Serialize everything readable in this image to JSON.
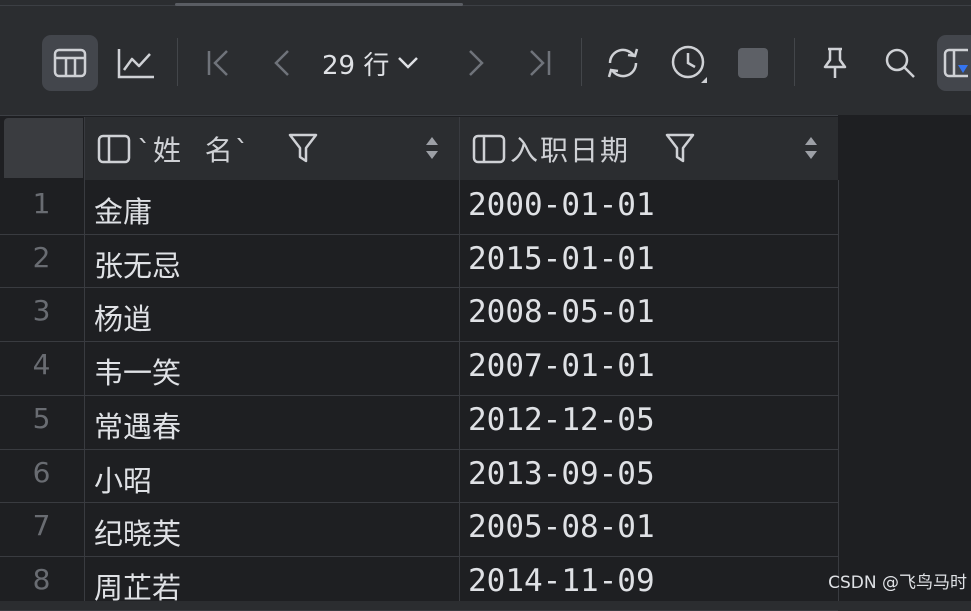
{
  "toolbar": {
    "row_count": "29 行",
    "buttons": [
      "table-view",
      "chart-view",
      "first-page",
      "previous-page",
      "next-page",
      "last-page",
      "refresh",
      "history",
      "stop",
      "pin",
      "search",
      "view-options"
    ]
  },
  "grid": {
    "columns": [
      {
        "label": "`姓  名`"
      },
      {
        "label": "入职日期"
      }
    ],
    "rows": [
      {
        "num": "1",
        "name": "金庸",
        "date": "2000-01-01"
      },
      {
        "num": "2",
        "name": "张无忌",
        "date": "2015-01-01"
      },
      {
        "num": "3",
        "name": "杨逍",
        "date": "2008-05-01"
      },
      {
        "num": "4",
        "name": "韦一笑",
        "date": "2007-01-01"
      },
      {
        "num": "5",
        "name": "常遇春",
        "date": "2012-12-05"
      },
      {
        "num": "6",
        "name": "小昭",
        "date": "2013-09-05"
      },
      {
        "num": "7",
        "name": "纪晓芙",
        "date": "2005-08-01"
      },
      {
        "num": "8",
        "name": "周芷若",
        "date": "2014-11-09"
      }
    ]
  },
  "watermark": "CSDN @飞鸟马时",
  "colors": {
    "background": "#1e1f22",
    "toolbar": "#2b2d30",
    "text": "#dfe1e5",
    "muted": "#696c72"
  }
}
